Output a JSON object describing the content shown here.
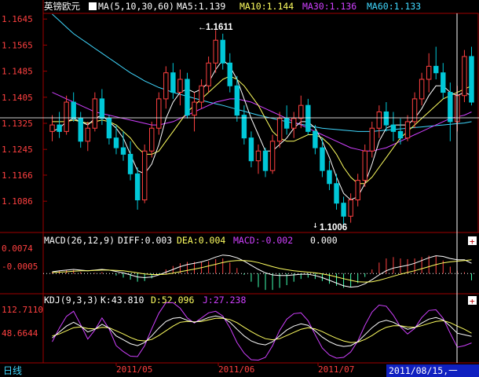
{
  "main_panel": {
    "symbol": "英镑欧元",
    "ma_header": "MA(5,10,30,60)",
    "ma5": "MA5:1.139",
    "ma10": "MA10:1.144",
    "ma30": "MA30:1.136",
    "ma60": "MA60:1.133",
    "y_ticks": [
      "1.1645",
      "1.1565",
      "1.1485",
      "1.1405",
      "1.1325",
      "1.1245",
      "1.1166",
      "1.1086"
    ],
    "high_label": "1.1611",
    "low_label": "1.1006"
  },
  "macd_panel": {
    "header": "MACD(26,12,9)",
    "diff": "DIFF:0.003",
    "dea": "DEA:0.004",
    "macd": "MACD:-0.002",
    "extra": "0.000",
    "y_ticks": [
      "0.0074",
      "-0.0005"
    ]
  },
  "kdj_panel": {
    "header": "KDJ(9,3,3)",
    "k": "K:43.810",
    "d": "D:52.096",
    "j": "J:27.238",
    "y_ticks": [
      "112.7110",
      "48.6644"
    ]
  },
  "bottom_bar": {
    "period_label": "日线",
    "dates": [
      "2011/05",
      "2011/06",
      "2011/07"
    ],
    "cursor_date": "2011/08/15,一"
  },
  "colors": {
    "up": "#ff4040",
    "down": "#00c8d8",
    "ma5": "#ffffff",
    "ma10": "#ffff60",
    "ma30": "#d040ff",
    "ma60": "#40d8ff",
    "grid": "#a00000"
  },
  "chart_data": {
    "type": "candlestick",
    "candles": [
      {
        "o": 1.13,
        "h": 1.135,
        "l": 1.127,
        "c": 1.132
      },
      {
        "o": 1.132,
        "h": 1.136,
        "l": 1.128,
        "c": 1.13
      },
      {
        "o": 1.13,
        "h": 1.141,
        "l": 1.129,
        "c": 1.139
      },
      {
        "o": 1.139,
        "h": 1.142,
        "l": 1.133,
        "c": 1.134
      },
      {
        "o": 1.134,
        "h": 1.136,
        "l": 1.125,
        "c": 1.127
      },
      {
        "o": 1.127,
        "h": 1.133,
        "l": 1.124,
        "c": 1.131
      },
      {
        "o": 1.131,
        "h": 1.142,
        "l": 1.13,
        "c": 1.14
      },
      {
        "o": 1.14,
        "h": 1.143,
        "l": 1.132,
        "c": 1.134
      },
      {
        "o": 1.134,
        "h": 1.135,
        "l": 1.126,
        "c": 1.128
      },
      {
        "o": 1.128,
        "h": 1.132,
        "l": 1.123,
        "c": 1.125
      },
      {
        "o": 1.125,
        "h": 1.13,
        "l": 1.121,
        "c": 1.123
      },
      {
        "o": 1.123,
        "h": 1.127,
        "l": 1.115,
        "c": 1.117
      },
      {
        "o": 1.117,
        "h": 1.119,
        "l": 1.106,
        "c": 1.109
      },
      {
        "o": 1.109,
        "h": 1.126,
        "l": 1.108,
        "c": 1.124
      },
      {
        "o": 1.124,
        "h": 1.133,
        "l": 1.122,
        "c": 1.131
      },
      {
        "o": 1.131,
        "h": 1.142,
        "l": 1.129,
        "c": 1.14
      },
      {
        "o": 1.14,
        "h": 1.15,
        "l": 1.137,
        "c": 1.148
      },
      {
        "o": 1.148,
        "h": 1.151,
        "l": 1.14,
        "c": 1.142
      },
      {
        "o": 1.142,
        "h": 1.149,
        "l": 1.138,
        "c": 1.146
      },
      {
        "o": 1.146,
        "h": 1.148,
        "l": 1.134,
        "c": 1.135
      },
      {
        "o": 1.135,
        "h": 1.142,
        "l": 1.13,
        "c": 1.139
      },
      {
        "o": 1.139,
        "h": 1.146,
        "l": 1.137,
        "c": 1.144
      },
      {
        "o": 1.144,
        "h": 1.153,
        "l": 1.142,
        "c": 1.151
      },
      {
        "o": 1.151,
        "h": 1.1611,
        "l": 1.148,
        "c": 1.158
      },
      {
        "o": 1.158,
        "h": 1.16,
        "l": 1.149,
        "c": 1.151
      },
      {
        "o": 1.151,
        "h": 1.154,
        "l": 1.142,
        "c": 1.144
      },
      {
        "o": 1.144,
        "h": 1.147,
        "l": 1.133,
        "c": 1.135
      },
      {
        "o": 1.135,
        "h": 1.138,
        "l": 1.126,
        "c": 1.128
      },
      {
        "o": 1.128,
        "h": 1.13,
        "l": 1.119,
        "c": 1.121
      },
      {
        "o": 1.121,
        "h": 1.126,
        "l": 1.117,
        "c": 1.124
      },
      {
        "o": 1.124,
        "h": 1.125,
        "l": 1.116,
        "c": 1.118
      },
      {
        "o": 1.118,
        "h": 1.129,
        "l": 1.117,
        "c": 1.127
      },
      {
        "o": 1.127,
        "h": 1.136,
        "l": 1.125,
        "c": 1.134
      },
      {
        "o": 1.134,
        "h": 1.138,
        "l": 1.129,
        "c": 1.131
      },
      {
        "o": 1.131,
        "h": 1.136,
        "l": 1.128,
        "c": 1.134
      },
      {
        "o": 1.134,
        "h": 1.141,
        "l": 1.131,
        "c": 1.138
      },
      {
        "o": 1.138,
        "h": 1.14,
        "l": 1.129,
        "c": 1.13
      },
      {
        "o": 1.13,
        "h": 1.132,
        "l": 1.123,
        "c": 1.125
      },
      {
        "o": 1.125,
        "h": 1.128,
        "l": 1.116,
        "c": 1.118
      },
      {
        "o": 1.118,
        "h": 1.121,
        "l": 1.112,
        "c": 1.114
      },
      {
        "o": 1.114,
        "h": 1.117,
        "l": 1.106,
        "c": 1.108
      },
      {
        "o": 1.108,
        "h": 1.11,
        "l": 1.1006,
        "c": 1.104
      },
      {
        "o": 1.104,
        "h": 1.111,
        "l": 1.102,
        "c": 1.109
      },
      {
        "o": 1.109,
        "h": 1.117,
        "l": 1.107,
        "c": 1.115
      },
      {
        "o": 1.115,
        "h": 1.126,
        "l": 1.113,
        "c": 1.124
      },
      {
        "o": 1.124,
        "h": 1.133,
        "l": 1.122,
        "c": 1.131
      },
      {
        "o": 1.131,
        "h": 1.138,
        "l": 1.128,
        "c": 1.136
      },
      {
        "o": 1.136,
        "h": 1.139,
        "l": 1.13,
        "c": 1.132
      },
      {
        "o": 1.132,
        "h": 1.136,
        "l": 1.127,
        "c": 1.13
      },
      {
        "o": 1.13,
        "h": 1.134,
        "l": 1.126,
        "c": 1.128
      },
      {
        "o": 1.128,
        "h": 1.135,
        "l": 1.127,
        "c": 1.133
      },
      {
        "o": 1.133,
        "h": 1.142,
        "l": 1.131,
        "c": 1.14
      },
      {
        "o": 1.14,
        "h": 1.148,
        "l": 1.138,
        "c": 1.146
      },
      {
        "o": 1.146,
        "h": 1.154,
        "l": 1.142,
        "c": 1.15
      },
      {
        "o": 1.15,
        "h": 1.156,
        "l": 1.146,
        "c": 1.148
      },
      {
        "o": 1.148,
        "h": 1.151,
        "l": 1.14,
        "c": 1.142
      },
      {
        "o": 1.142,
        "h": 1.145,
        "l": 1.127,
        "c": 1.133
      },
      {
        "o": 1.133,
        "h": 1.144,
        "l": 1.13,
        "c": 1.141
      },
      {
        "o": 1.141,
        "h": 1.155,
        "l": 1.139,
        "c": 1.153
      },
      {
        "o": 1.153,
        "h": 1.156,
        "l": 1.138,
        "c": 1.139
      }
    ],
    "ma5": [
      1.13,
      1.131,
      1.133,
      1.134,
      1.133,
      1.132,
      1.134,
      1.135,
      1.133,
      1.131,
      1.128,
      1.123,
      1.118,
      1.117,
      1.12,
      1.126,
      1.134,
      1.139,
      1.142,
      1.143,
      1.142,
      1.143,
      1.145,
      1.149,
      1.152,
      1.15,
      1.146,
      1.14,
      1.134,
      1.129,
      1.124,
      1.124,
      1.126,
      1.128,
      1.131,
      1.133,
      1.133,
      1.131,
      1.127,
      1.122,
      1.116,
      1.111,
      1.109,
      1.11,
      1.114,
      1.12,
      1.127,
      1.131,
      1.132,
      1.132,
      1.132,
      1.134,
      1.137,
      1.141,
      1.144,
      1.144,
      1.142,
      1.141,
      1.142,
      1.141
    ],
    "ma10": [
      1.133,
      1.133,
      1.133,
      1.1335,
      1.133,
      1.1325,
      1.133,
      1.1335,
      1.133,
      1.132,
      1.13,
      1.128,
      1.125,
      1.123,
      1.123,
      1.124,
      1.127,
      1.13,
      1.133,
      1.136,
      1.138,
      1.14,
      1.142,
      1.144,
      1.146,
      1.147,
      1.146,
      1.144,
      1.141,
      1.138,
      1.134,
      1.13,
      1.128,
      1.127,
      1.127,
      1.128,
      1.129,
      1.129,
      1.128,
      1.126,
      1.123,
      1.119,
      1.116,
      1.114,
      1.114,
      1.116,
      1.119,
      1.122,
      1.125,
      1.128,
      1.13,
      1.132,
      1.134,
      1.136,
      1.138,
      1.14,
      1.141,
      1.142,
      1.143,
      1.144
    ],
    "ma30": [
      1.142,
      1.141,
      1.14,
      1.139,
      1.138,
      1.137,
      1.136,
      1.1355,
      1.135,
      1.1345,
      1.134,
      1.1335,
      1.133,
      1.1325,
      1.132,
      1.132,
      1.1325,
      1.133,
      1.134,
      1.135,
      1.136,
      1.137,
      1.138,
      1.139,
      1.1395,
      1.14,
      1.14,
      1.1395,
      1.139,
      1.138,
      1.137,
      1.136,
      1.135,
      1.134,
      1.133,
      1.132,
      1.131,
      1.13,
      1.129,
      1.128,
      1.127,
      1.126,
      1.125,
      1.1245,
      1.124,
      1.124,
      1.1245,
      1.125,
      1.126,
      1.127,
      1.128,
      1.129,
      1.13,
      1.131,
      1.132,
      1.133,
      1.134,
      1.1345,
      1.135,
      1.136
    ],
    "ma60": [
      1.166,
      1.164,
      1.162,
      1.16,
      1.1585,
      1.157,
      1.1555,
      1.154,
      1.1525,
      1.151,
      1.1495,
      1.148,
      1.1468,
      1.1455,
      1.1445,
      1.1435,
      1.1428,
      1.142,
      1.1414,
      1.1408,
      1.1402,
      1.1396,
      1.139,
      1.1385,
      1.138,
      1.1374,
      1.1368,
      1.1362,
      1.1356,
      1.135,
      1.1345,
      1.134,
      1.1335,
      1.133,
      1.1326,
      1.1322,
      1.1318,
      1.1314,
      1.131,
      1.1308,
      1.1306,
      1.1304,
      1.1302,
      1.13,
      1.13,
      1.13,
      1.1302,
      1.1304,
      1.1306,
      1.1308,
      1.131,
      1.1312,
      1.1314,
      1.1316,
      1.1318,
      1.132,
      1.1322,
      1.1324,
      1.1326,
      1.133
    ],
    "macd_diff": [
      0.0005,
      0.0008,
      0.001,
      0.0012,
      0.001,
      0.0008,
      0.001,
      0.0012,
      0.001,
      0.0006,
      0.0002,
      -0.0004,
      -0.001,
      -0.0012,
      -0.001,
      -0.0004,
      0.0004,
      0.0012,
      0.002,
      0.0026,
      0.003,
      0.0034,
      0.004,
      0.0048,
      0.0054,
      0.0052,
      0.0046,
      0.0036,
      0.0024,
      0.0012,
      0.0002,
      -0.0004,
      -0.0006,
      -0.0006,
      -0.0004,
      -0.0002,
      -0.0002,
      -0.0006,
      -0.0012,
      -0.002,
      -0.0028,
      -0.0036,
      -0.004,
      -0.0038,
      -0.003,
      -0.0018,
      -0.0004,
      0.0008,
      0.0016,
      0.002,
      0.0024,
      0.003,
      0.0038,
      0.0046,
      0.0052,
      0.005,
      0.0044,
      0.004,
      0.004,
      0.003
    ],
    "macd_dea": [
      0.0003,
      0.0004,
      0.0005,
      0.0007,
      0.0008,
      0.0008,
      0.0009,
      0.001,
      0.001,
      0.0009,
      0.0008,
      0.0005,
      0.0002,
      -0.0001,
      -0.0003,
      -0.0003,
      -0.0002,
      0.0001,
      0.0005,
      0.0009,
      0.0013,
      0.0017,
      0.0022,
      0.0027,
      0.0032,
      0.0036,
      0.0038,
      0.0038,
      0.0036,
      0.0032,
      0.0026,
      0.002,
      0.0015,
      0.0011,
      0.0008,
      0.0006,
      0.0004,
      0.0002,
      -0.0001,
      -0.0005,
      -0.001,
      -0.0015,
      -0.002,
      -0.0024,
      -0.0025,
      -0.0024,
      -0.002,
      -0.0014,
      -0.0008,
      -0.0002,
      0.0003,
      0.0008,
      0.0014,
      0.002,
      0.0026,
      0.0031,
      0.0034,
      0.0036,
      0.0038,
      0.004
    ],
    "kdj_k": [
      40,
      55,
      70,
      80,
      70,
      55,
      62,
      75,
      65,
      45,
      35,
      25,
      20,
      28,
      45,
      65,
      82,
      90,
      92,
      85,
      80,
      85,
      92,
      96,
      92,
      80,
      62,
      45,
      32,
      25,
      22,
      30,
      45,
      60,
      70,
      76,
      72,
      58,
      42,
      30,
      22,
      18,
      20,
      30,
      48,
      66,
      80,
      85,
      80,
      70,
      62,
      66,
      78,
      88,
      92,
      86,
      70,
      52,
      48,
      44
    ],
    "kdj_d": [
      45,
      50,
      58,
      66,
      68,
      64,
      63,
      67,
      66,
      58,
      50,
      41,
      34,
      32,
      36,
      46,
      58,
      70,
      80,
      82,
      81,
      82,
      86,
      90,
      90,
      87,
      79,
      67,
      56,
      46,
      38,
      35,
      38,
      46,
      54,
      62,
      66,
      63,
      56,
      47,
      39,
      32,
      28,
      29,
      36,
      46,
      58,
      67,
      71,
      71,
      68,
      67,
      71,
      77,
      82,
      84,
      79,
      70,
      62,
      52
    ],
    "kdj_j": [
      30,
      65,
      95,
      108,
      74,
      37,
      60,
      91,
      63,
      20,
      5,
      -7,
      -8,
      20,
      63,
      103,
      130,
      130,
      116,
      91,
      78,
      91,
      104,
      108,
      96,
      66,
      28,
      1,
      -16,
      -17,
      -10,
      20,
      59,
      88,
      102,
      104,
      84,
      48,
      14,
      -4,
      -12,
      -10,
      4,
      32,
      72,
      106,
      124,
      121,
      98,
      68,
      50,
      64,
      92,
      110,
      112,
      90,
      52,
      16,
      20,
      27
    ]
  }
}
